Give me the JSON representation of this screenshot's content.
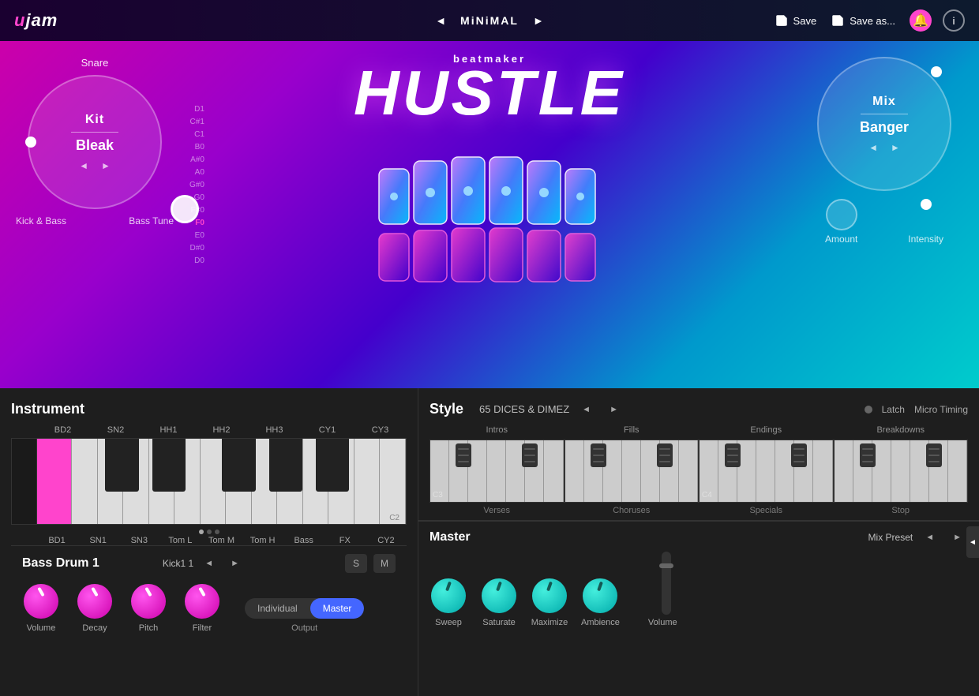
{
  "topbar": {
    "logo": "ujam",
    "preset_name": "MiNiMAL",
    "nav_prev": "◄",
    "nav_next": "►",
    "save_label": "Save",
    "save_as_label": "Save as...",
    "notification_icon": "bell",
    "info_icon": "i"
  },
  "kit_panel": {
    "snare_label": "Snare",
    "knob_title": "Kit",
    "knob_value": "Bleak",
    "nav_prev": "◄",
    "nav_next": "►",
    "label_left": "Kick & Bass",
    "label_right": "Bass Tune",
    "notes": [
      "D1",
      "C#1",
      "C1",
      "B0",
      "A#0",
      "A0",
      "G#0",
      "G0",
      "F#0",
      "F0",
      "E0",
      "D#0",
      "D0"
    ],
    "active_note": "F0"
  },
  "mix_panel": {
    "knob_title": "Mix",
    "knob_value": "Banger",
    "nav_prev": "◄",
    "nav_next": "►",
    "amount_label": "Amount",
    "intensity_label": "Intensity"
  },
  "branding": {
    "beatmaker": "beatMaker",
    "title": "HuSTLE"
  },
  "instrument_panel": {
    "title": "Instrument",
    "drum_labels_top": [
      "BD2",
      "SN2",
      "HH1",
      "HH2",
      "HH3",
      "CY1",
      "CY3"
    ],
    "drum_labels_bottom": [
      "BD1",
      "SN1",
      "SN3",
      "Tom L",
      "Tom M",
      "Tom H",
      "Bass",
      "FX",
      "CY2"
    ],
    "c2_label": "C2"
  },
  "bass_drum": {
    "title": "Bass Drum 1",
    "preset_name": "Kick1 1",
    "nav_prev": "◄",
    "nav_next": "►",
    "s_label": "S",
    "m_label": "M",
    "volume_label": "Volume",
    "decay_label": "Decay",
    "pitch_label": "Pitch",
    "filter_label": "Filter",
    "individual_label": "Individual",
    "master_label": "Master",
    "output_label": "Output"
  },
  "style_panel": {
    "title": "Style",
    "preset_name": "65 DICES & DIMEZ",
    "nav_prev": "◄",
    "nav_next": "►",
    "latch_label": "Latch",
    "micro_timing_label": "Micro Timing",
    "sections": [
      "Intros",
      "Fills",
      "Endings",
      "Breakdowns"
    ],
    "bottom_labels": [
      "Verses",
      "Choruses",
      "Specials",
      "Stop"
    ],
    "c3_label": "C3",
    "c4_label": "C4"
  },
  "master_panel": {
    "title": "Master",
    "preset_name": "Mix Preset",
    "nav_prev": "◄",
    "nav_next": "►",
    "knobs": [
      "Sweep",
      "Saturate",
      "Maximize",
      "Ambience"
    ],
    "volume_label": "Volume"
  }
}
